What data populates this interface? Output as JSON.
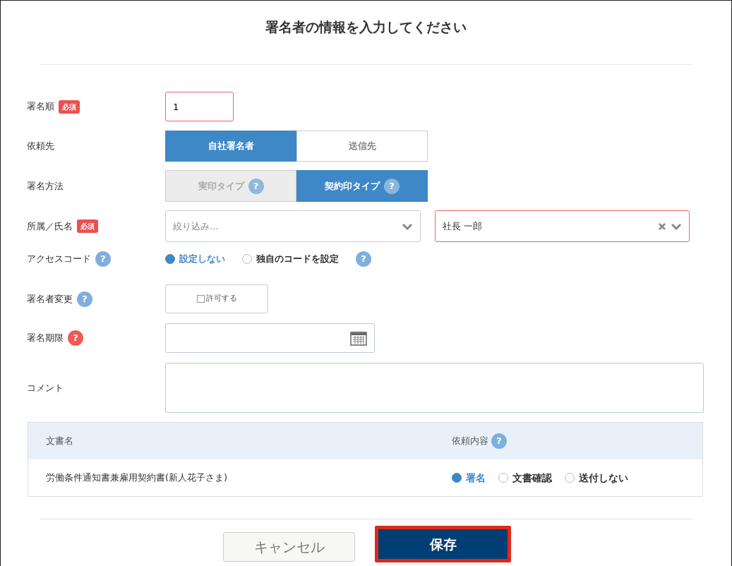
{
  "title": "署名者の情報を入力してください",
  "fields": [
    {
      "kind": "text",
      "label": "署名順",
      "required": "必須",
      "value": "1",
      "invalid": true
    },
    {
      "kind": "toggle",
      "label": "依頼先",
      "options": [
        {
          "label": "自社署名者",
          "selected": true,
          "disabled": false
        },
        {
          "label": "送信先",
          "selected": false,
          "disabled": false
        }
      ]
    },
    {
      "kind": "toggle",
      "label": "署名方法",
      "options": [
        {
          "label": "実印タイプ",
          "selected": false,
          "disabled": true,
          "help": "?"
        },
        {
          "label": "契約印タイプ",
          "selected": true,
          "disabled": false,
          "help": "?"
        }
      ]
    },
    {
      "kind": "select",
      "label": "所属／氏名",
      "required": "必須",
      "selects": [
        {
          "placeholder": "絞り込み...",
          "invalid": false,
          "clearable": false
        },
        {
          "value": "社長 一郎",
          "invalid": true,
          "clearable": true
        }
      ]
    },
    {
      "kind": "radio",
      "label": "アクセスコード",
      "help": "?",
      "color": "#7fb0dc",
      "options": [
        {
          "label": "設定しない",
          "selected": true
        },
        {
          "label": "独自のコードを設定",
          "selected": false
        }
      ],
      "options_help": "?"
    },
    {
      "kind": "checkbox",
      "label": "署名者変更",
      "help": "?",
      "color": "#7fb0dc",
      "checkbox": {
        "label": "許可する",
        "checked": false
      }
    },
    {
      "kind": "date",
      "label": "署名期限",
      "help": "?",
      "color": "#ef5a55"
    },
    {
      "kind": "textarea",
      "label": "コメント"
    }
  ],
  "table": {
    "columns": [
      {
        "label": "文書名"
      },
      {
        "label": "依頼内容",
        "help": "?"
      }
    ],
    "rows": [
      {
        "document": "労働条件通知書兼雇用契約書(新人花子さま)",
        "options": [
          {
            "label": "署名",
            "selected": true
          },
          {
            "label": "文書確認",
            "selected": false
          },
          {
            "label": "送付しない",
            "selected": false
          }
        ]
      }
    ]
  },
  "buttons": [
    {
      "label": "キャンセル",
      "kind": "secondary",
      "highlighted": false
    },
    {
      "label": "保存",
      "kind": "primary",
      "highlighted": true
    }
  ]
}
